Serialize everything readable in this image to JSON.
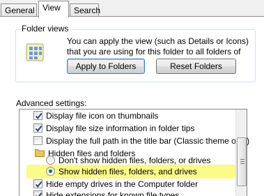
{
  "tabs": [
    {
      "label": "General"
    },
    {
      "label": "View"
    },
    {
      "label": "Search"
    }
  ],
  "folder_views": {
    "title": "Folder views",
    "description": "You can apply the view (such as Details or Icons) that you are using for this folder to all folders of this type.",
    "apply_button": "Apply to Folders",
    "reset_button": "Reset Folders"
  },
  "advanced": {
    "label": "Advanced settings:",
    "items": [
      {
        "label": "Display file icon on thumbnails",
        "type": "checkbox",
        "checked": true
      },
      {
        "label": "Display file size information in folder tips",
        "type": "checkbox",
        "checked": true
      },
      {
        "label": "Display the full path in the title bar (Classic theme only)",
        "type": "checkbox",
        "checked": false
      },
      {
        "label": "Hidden files and folders",
        "type": "folder"
      },
      {
        "label": "Don't show hidden files, folders, or drives",
        "type": "radio",
        "checked": false
      },
      {
        "label": "Show hidden files, folders, and drives",
        "type": "radio",
        "checked": true
      },
      {
        "label": "Hide empty drives in the Computer folder",
        "type": "checkbox",
        "checked": true
      },
      {
        "label": "Hide extensions for known file types",
        "type": "checkbox",
        "checked": true
      }
    ]
  },
  "colors": {
    "highlight": "#fbfb89",
    "radio_on": "#1c7d1c"
  }
}
